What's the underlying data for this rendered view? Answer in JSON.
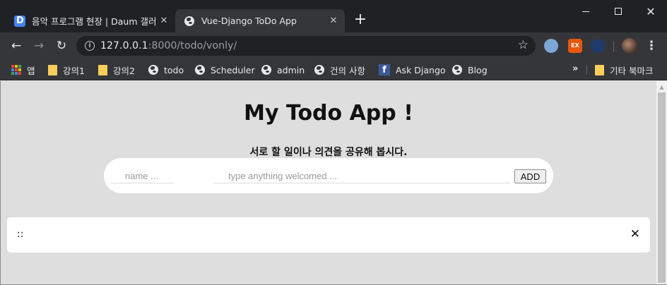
{
  "browser": {
    "tabs": [
      {
        "title": "음악 프로그램 현장 | Daum 갤러리",
        "favicon": "daum-icon"
      },
      {
        "title": "Vue-Django ToDo App",
        "favicon": "globe-icon"
      }
    ],
    "url": {
      "host": "127.0.0.1",
      "rest": ":8000/todo/vonly/"
    },
    "bookmarks": [
      {
        "label": "앱",
        "icon": "apps-icon"
      },
      {
        "label": "강의1",
        "icon": "folder-icon"
      },
      {
        "label": "강의2",
        "icon": "folder-icon"
      },
      {
        "label": "todo",
        "icon": "globe-icon"
      },
      {
        "label": "Scheduler",
        "icon": "globe-icon"
      },
      {
        "label": "admin",
        "icon": "globe-icon"
      },
      {
        "label": "건의 사항",
        "icon": "globe-icon"
      },
      {
        "label": "Ask Django",
        "icon": "facebook-icon"
      },
      {
        "label": "Blog",
        "icon": "globe-icon"
      }
    ],
    "other_bookmarks": "기타 북마크",
    "extension_label": "EX"
  },
  "app": {
    "title": "My Todo App !",
    "subtitle": "서로 할 일이나 의견을 공유해 봅시다.",
    "name_placeholder": "name ...",
    "todo_placeholder": "type anything welcomed ...",
    "add_label": "ADD",
    "todos": [
      {
        "text": "::",
        "remove": "✕"
      }
    ]
  }
}
